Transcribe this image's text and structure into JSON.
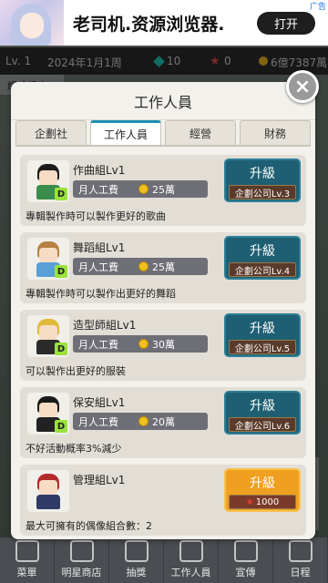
{
  "ad": {
    "title": "老司机.资源浏览器.",
    "open_label": "打开",
    "tag": "广告"
  },
  "hud": {
    "level": "Lv. 1",
    "date": "2024年1月1周",
    "gems": "10",
    "stars": "0",
    "money": "6億7387萬",
    "group_label": "組成組合"
  },
  "modal": {
    "title": "工作人員",
    "close_symbol": "×",
    "tabs": [
      "企劃社",
      "工作人員",
      "經營",
      "財務"
    ],
    "active_tab": 1
  },
  "staff": [
    {
      "name": "作曲組Lv1",
      "salary_label": "月人工費",
      "salary": "25萬",
      "desc": "專輯製作時可以製作更好的歌曲",
      "upgrade_label": "升級",
      "requirement": "企劃公司Lv.3",
      "hair_color": "#1c1c1c",
      "body_color": "#3a8d4a"
    },
    {
      "name": "舞蹈組Lv1",
      "salary_label": "月人工費",
      "salary": "25萬",
      "desc": "專輯製作時可以製作出更好的舞蹈",
      "upgrade_label": "升級",
      "requirement": "企劃公司Lv.4",
      "hair_color": "#b78040",
      "body_color": "#5aa0d8"
    },
    {
      "name": "造型師組Lv1",
      "salary_label": "月人工費",
      "salary": "30萬",
      "desc": "可以製作出更好的服裝",
      "upgrade_label": "升級",
      "requirement": "企劃公司Lv.5",
      "hair_color": "#e3b93a",
      "body_color": "#2b2b2b"
    },
    {
      "name": "保安組Lv1",
      "salary_label": "月人工費",
      "salary": "20萬",
      "desc": "不好活動概率3%減少",
      "upgrade_label": "升級",
      "requirement": "企劃公司Lv.6",
      "hair_color": "#1a1a1a",
      "body_color": "#222222"
    },
    {
      "name": "管理組Lv1",
      "desc": "最大可擁有的偶像組合數：2",
      "upgrade_label": "升級",
      "requirement": "1000",
      "hair_color": "#b32a2a",
      "body_color": "#2f3a66"
    }
  ],
  "nav": [
    "菜單",
    "明星商店",
    "抽獎",
    "工作人員",
    "宣傳",
    "日程"
  ]
}
